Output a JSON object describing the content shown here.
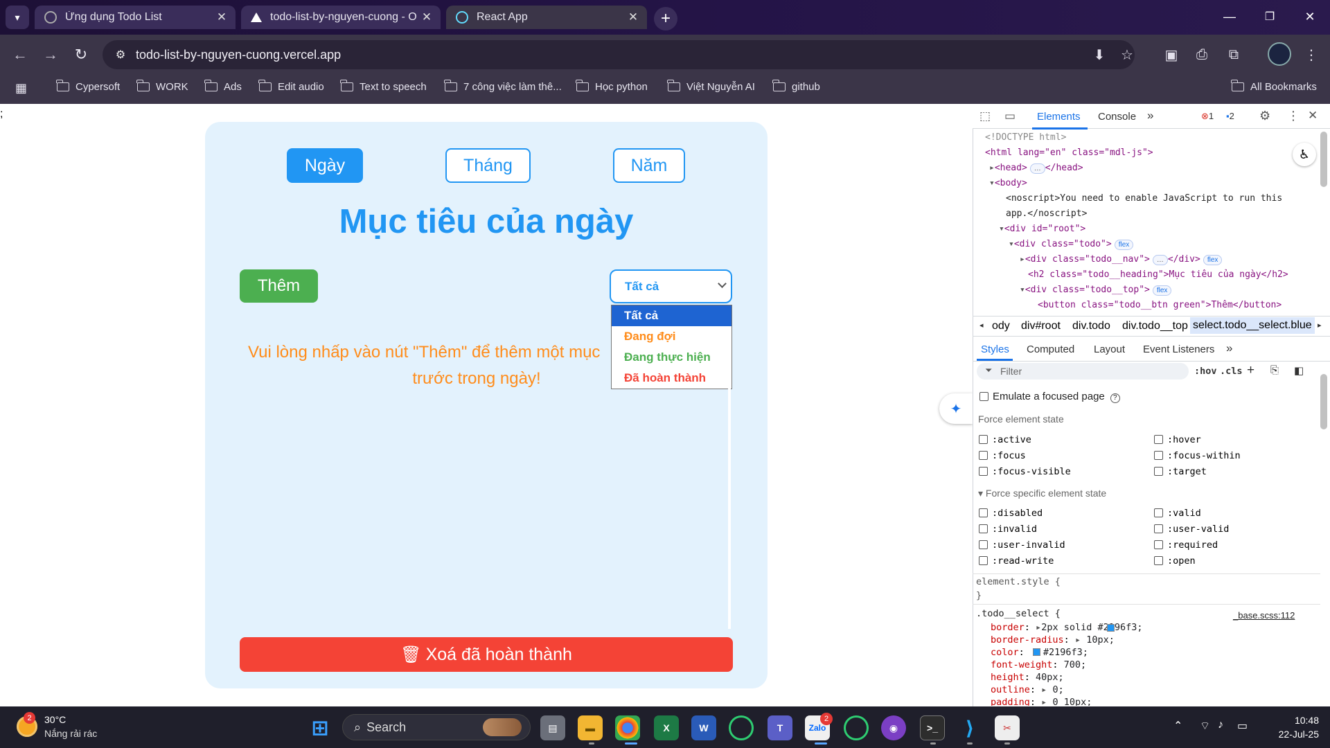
{
  "browser": {
    "tabs": [
      {
        "title": "Ứng dụng Todo List",
        "favicon": "globe-icon"
      },
      {
        "title": "todo-list-by-nguyen-cuong - O",
        "favicon": "vercel-icon"
      },
      {
        "title": "React App",
        "favicon": "react-icon"
      }
    ],
    "url": "todo-list-by-nguyen-cuong.vercel.app",
    "bookmarks": [
      "Cypersoft",
      "WORK",
      "Ads",
      "Edit audio",
      "Text to speech",
      "7 công việc làm thê...",
      "Học python",
      "Việt Nguyễn AI",
      "github"
    ],
    "all_bookmarks": "All Bookmarks"
  },
  "page": {
    "stray_text": ";",
    "nav": [
      "Ngày",
      "Tháng",
      "Năm"
    ],
    "heading": "Mục tiêu của ngày",
    "add_label": "Thêm",
    "select_value": "Tất cả",
    "options": [
      {
        "label": "Tất cả",
        "color": "#ffffff"
      },
      {
        "label": "Đang đợi",
        "color": "#ff8c1a"
      },
      {
        "label": "Đang thực hiện",
        "color": "#4caf50"
      },
      {
        "label": "Đã hoàn thành",
        "color": "#f44336"
      }
    ],
    "empty_line1": "Vui lòng nhấp vào nút \"Thêm\" để thêm một mục",
    "empty_line2": "trước trong ngày!",
    "clear_label": "Xoá đã hoàn thành",
    "colors": {
      "primary": "#2196f3",
      "green": "#4caf50",
      "red": "#f44336",
      "orange": "#ff8c1a",
      "card": "#e3f2fd"
    }
  },
  "devtools": {
    "tabs": [
      "Elements",
      "Console"
    ],
    "errors": "1",
    "messages": "2",
    "dom": [
      "<!DOCTYPE html>",
      "<html lang=\"en\" class=\"mdl-js\">",
      "<head>",
      "</head>",
      "<body>",
      "<noscript>You need to enable JavaScript to run this",
      "app.</noscript>",
      "<div id=\"root\">",
      "<div class=\"todo\">",
      "<div class=\"todo__nav\">",
      "</div>",
      "<h2 class=\"todo__heading\">Mục tiêu của ngày</h2>",
      "<div class=\"todo__top\">",
      "<button class=\"todo__btn green\">Thêm</button>",
      "flex"
    ],
    "breadcrumbs": [
      "ody",
      "div#root",
      "div.todo",
      "div.todo__top",
      "select.todo__select.blue"
    ],
    "sub_tabs": [
      "Styles",
      "Computed",
      "Layout",
      "Event Listeners"
    ],
    "filter_placeholder": "Filter",
    "hov": ":hov",
    "cls": ".cls",
    "emulate": "Emulate a focused page",
    "force_state": "Force element state",
    "force_specific": "Force specific element state",
    "states_left": [
      ":active",
      ":focus",
      ":focus-visible"
    ],
    "states_right": [
      ":hover",
      ":focus-within",
      ":target"
    ],
    "specific_left": [
      ":disabled",
      ":invalid",
      ":user-invalid",
      ":read-write"
    ],
    "specific_right": [
      ":valid",
      ":user-valid",
      ":required",
      ":open"
    ],
    "element_style": "element.style {",
    "close_brace": "}",
    "rule_selector": ".todo__select {",
    "rule_source": "_base.scss:112",
    "rule_props": [
      {
        "name": "border",
        "value": "2px solid #2196f3;"
      },
      {
        "name": "border-radius",
        "value": "10px;"
      },
      {
        "name": "color",
        "value": "#2196f3;"
      },
      {
        "name": "font-weight",
        "value": "700;"
      },
      {
        "name": "height",
        "value": "40px;"
      },
      {
        "name": "outline",
        "value": "0;"
      },
      {
        "name": "padding",
        "value": "0 10px;"
      }
    ]
  },
  "taskbar": {
    "weather_temp": "30°C",
    "weather_desc": "Nắng rải rác",
    "weather_badge": "2",
    "search_label": "Search",
    "zalo_badge": "2",
    "time": "10:48",
    "date": "22-Jul-25"
  }
}
